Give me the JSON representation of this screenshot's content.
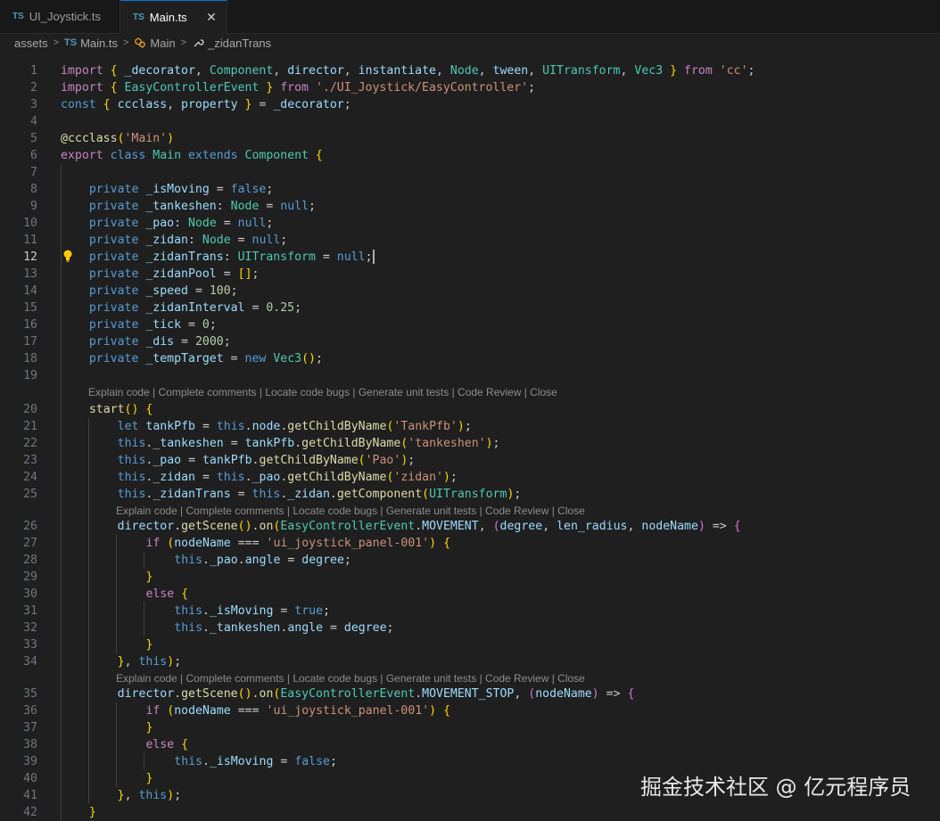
{
  "tabs": [
    {
      "icon": "TS",
      "label": "UI_Joystick.ts",
      "active": false
    },
    {
      "icon": "TS",
      "label": "Main.ts",
      "active": true
    }
  ],
  "tab_close_glyph": "✕",
  "breadcrumbs": [
    "assets",
    "Main.ts",
    "Main",
    "_zidanTrans"
  ],
  "breadcrumb_sep": ">",
  "codelens": "Explain code | Complete comments | Locate code bugs | Generate unit tests | Code Review | Close",
  "current_line": 12,
  "watermark": "掘金技术社区 @ 亿元程序员",
  "lines": [
    {
      "n": 1,
      "t": "import { _decorator, Component, director, instantiate, Node, tween, UITransform, Vec3 } from 'cc';"
    },
    {
      "n": 2,
      "t": "import { EasyControllerEvent } from './UI_Joystick/EasyController';"
    },
    {
      "n": 3,
      "t": "const { ccclass, property } = _decorator;"
    },
    {
      "n": 4,
      "t": ""
    },
    {
      "n": 5,
      "t": "@ccclass('Main')"
    },
    {
      "n": 6,
      "t": "export class Main extends Component {"
    },
    {
      "n": 7,
      "t": ""
    },
    {
      "n": 8,
      "t": "    private _isMoving = false;"
    },
    {
      "n": 9,
      "t": "    private _tankeshen: Node = null;"
    },
    {
      "n": 10,
      "t": "    private _pao: Node = null;"
    },
    {
      "n": 11,
      "t": "    private _zidan: Node = null;"
    },
    {
      "n": 12,
      "t": "    private _zidanTrans: UITransform = null;"
    },
    {
      "n": 13,
      "t": "    private _zidanPool = [];"
    },
    {
      "n": 14,
      "t": "    private _speed = 100;"
    },
    {
      "n": 15,
      "t": "    private _zidanInterval = 0.25;"
    },
    {
      "n": 16,
      "t": "    private _tick = 0;"
    },
    {
      "n": 17,
      "t": "    private _dis = 2000;"
    },
    {
      "n": 18,
      "t": "    private _tempTarget = new Vec3();"
    },
    {
      "n": 19,
      "t": ""
    },
    {
      "n": 20,
      "t": "    start() {"
    },
    {
      "n": 21,
      "t": "        let tankPfb = this.node.getChildByName('TankPfb');"
    },
    {
      "n": 22,
      "t": "        this._tankeshen = tankPfb.getChildByName('tankeshen');"
    },
    {
      "n": 23,
      "t": "        this._pao = tankPfb.getChildByName('Pao');"
    },
    {
      "n": 24,
      "t": "        this._zidan = this._pao.getChildByName('zidan');"
    },
    {
      "n": 25,
      "t": "        this._zidanTrans = this._zidan.getComponent(UITransform);"
    },
    {
      "n": 26,
      "t": "        director.getScene().on(EasyControllerEvent.MOVEMENT, (degree, len_radius, nodeName) => {"
    },
    {
      "n": 27,
      "t": "            if (nodeName === 'ui_joystick_panel-001') {"
    },
    {
      "n": 28,
      "t": "                this._pao.angle = degree;"
    },
    {
      "n": 29,
      "t": "            }"
    },
    {
      "n": 30,
      "t": "            else {"
    },
    {
      "n": 31,
      "t": "                this._isMoving = true;"
    },
    {
      "n": 32,
      "t": "                this._tankeshen.angle = degree;"
    },
    {
      "n": 33,
      "t": "            }"
    },
    {
      "n": 34,
      "t": "        }, this);"
    },
    {
      "n": 35,
      "t": "        director.getScene().on(EasyControllerEvent.MOVEMENT_STOP, (nodeName) => {"
    },
    {
      "n": 36,
      "t": "            if (nodeName === 'ui_joystick_panel-001') {"
    },
    {
      "n": 37,
      "t": "            }"
    },
    {
      "n": 38,
      "t": "            else {"
    },
    {
      "n": 39,
      "t": "                this._isMoving = false;"
    },
    {
      "n": 40,
      "t": "            }"
    },
    {
      "n": 41,
      "t": "        }, this);"
    },
    {
      "n": 42,
      "t": "    }"
    }
  ]
}
